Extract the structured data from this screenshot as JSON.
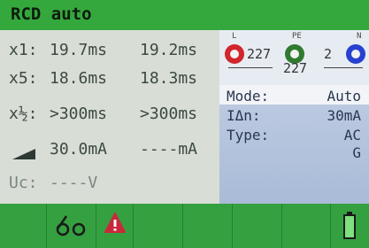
{
  "title": "RCD auto",
  "measurements": [
    {
      "label": "x1:",
      "value1": "19.7ms",
      "value2": "19.2ms"
    },
    {
      "label": "x5:",
      "value1": "18.6ms",
      "value2": "18.3ms"
    },
    {
      "label": "x½:",
      "value1": ">300ms",
      "value2": ">300ms"
    },
    {
      "label": "",
      "value1": "30.0mA",
      "value2": "----mA"
    }
  ],
  "uc": {
    "label": "Uc:",
    "value": "----V"
  },
  "terminals": {
    "l_label": "L",
    "pe_label": "PE",
    "n_label": "N",
    "l_pe_voltage": "227",
    "pe_n_voltage": "2",
    "l_n_voltage": "227"
  },
  "params": [
    {
      "key": "Mode:",
      "value": "Auto"
    },
    {
      "key": "IΔn:",
      "value": "30mA"
    },
    {
      "key": "Type:",
      "value": "AC"
    },
    {
      "key": "",
      "value": "G"
    }
  ],
  "status_icons": [
    "moon-icon",
    "test-leads-icon",
    "warning-icon",
    "battery-icon"
  ],
  "colors": {
    "title_bar": "#34a83c",
    "left_panel": "#d8ddd6",
    "right_panel": "#b7c6df",
    "status_bar": "#35a040",
    "socket_l": "#d0262c",
    "socket_pe": "#2f7a2f",
    "socket_n": "#2741d0",
    "warning": "#c8283c"
  }
}
